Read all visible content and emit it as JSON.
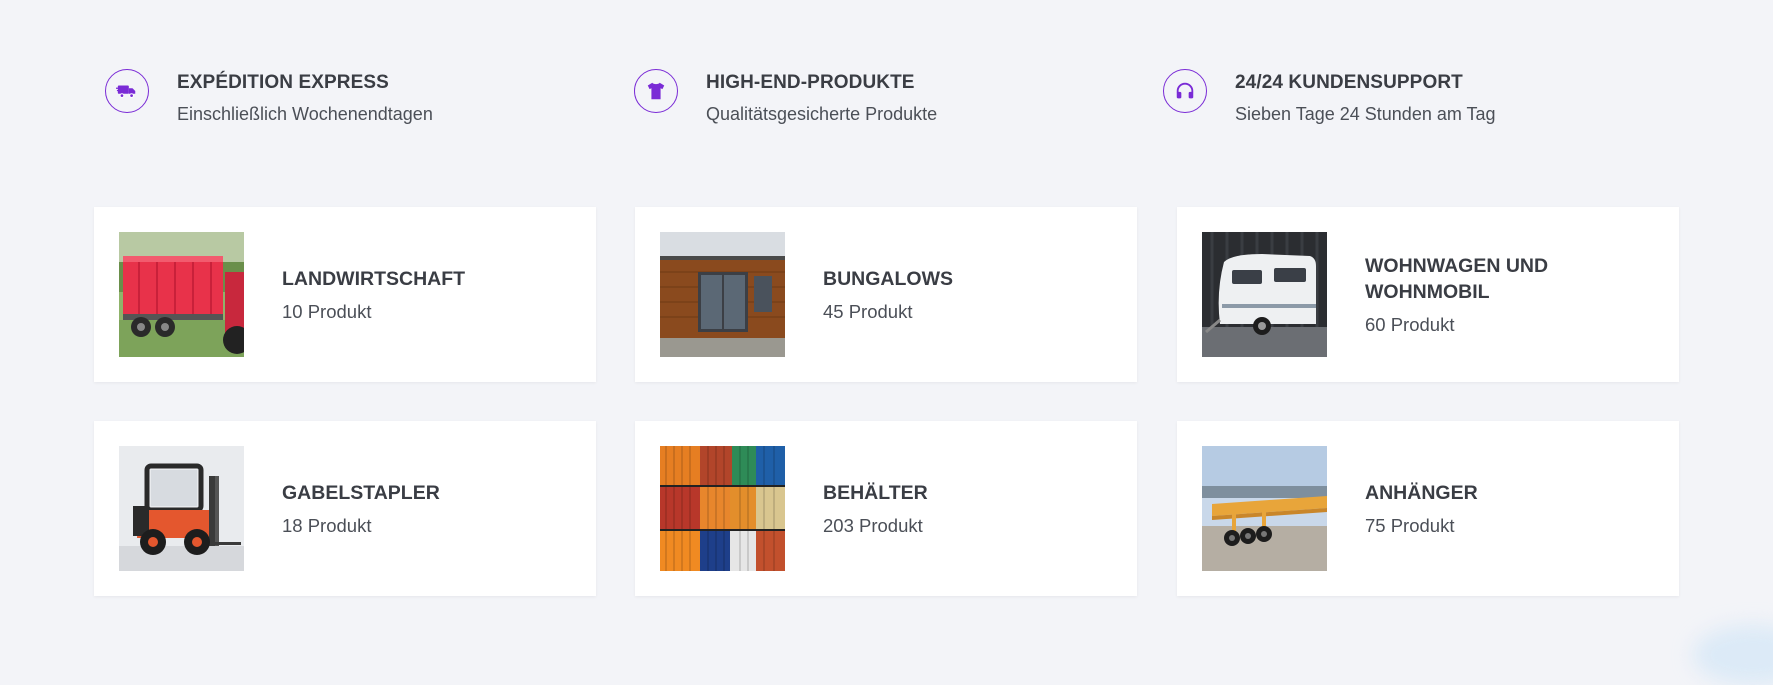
{
  "colors": {
    "accent": "#7a2bd6",
    "background": "#f3f4f8",
    "card": "#ffffff",
    "text": "#3a3d44"
  },
  "features": [
    {
      "icon": "truck-icon",
      "title": "EXPÉDITION EXPRESS",
      "subtitle": "Einschließlich Wochenendtagen"
    },
    {
      "icon": "tshirt-icon",
      "title": "HIGH-END-PRODUKTE",
      "subtitle": "Qualitätsgesicherte Produkte"
    },
    {
      "icon": "headphones-icon",
      "title": "24/24 KUNDENSUPPORT",
      "subtitle": "Sieben Tage 24 Stunden am Tag"
    }
  ],
  "categories": [
    {
      "title": "LANDWIRTSCHAFT",
      "count": "10 Produkt",
      "image": "agricultural-trailer-photo"
    },
    {
      "title": "BUNGALOWS",
      "count": "45 Produkt",
      "image": "bungalow-container-photo"
    },
    {
      "title": "WOHNWAGEN UND WOHNMOBIL",
      "count": "60 Produkt",
      "image": "caravan-photo"
    },
    {
      "title": "GABELSTAPLER",
      "count": "18 Produkt",
      "image": "forklift-photo"
    },
    {
      "title": "BEHÄLTER",
      "count": "203 Produkt",
      "image": "shipping-containers-photo"
    },
    {
      "title": "ANHÄNGER",
      "count": "75 Produkt",
      "image": "semi-trailer-photo"
    }
  ]
}
